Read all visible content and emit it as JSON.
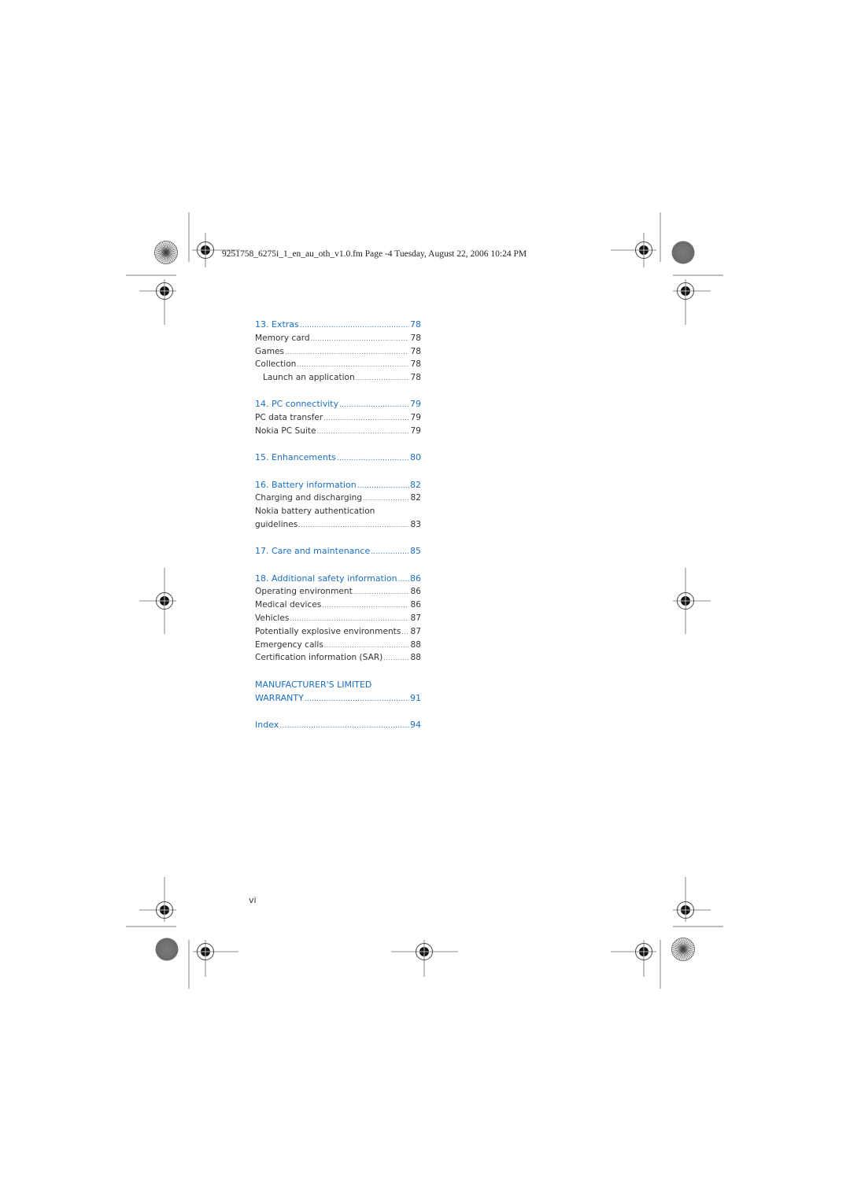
{
  "header": {
    "text": "9251758_6275i_1_en_au_oth_v1.0.fm  Page -4  Tuesday, August 22, 2006  10:24 PM"
  },
  "colors": {
    "accent": "#1a6fc0",
    "body_text": "#333333",
    "marks": "#555555"
  },
  "toc": {
    "sections": [
      {
        "chapter": {
          "label": "13. Extras",
          "page": "78"
        },
        "entries": [
          {
            "label": "Memory card",
            "page": "78",
            "indent": false
          },
          {
            "label": "Games",
            "page": "78",
            "indent": false
          },
          {
            "label": "Collection",
            "page": "78",
            "indent": false
          },
          {
            "label": "Launch an application",
            "page": "78",
            "indent": true
          }
        ]
      },
      {
        "chapter": {
          "label": "14. PC connectivity",
          "page": "79"
        },
        "entries": [
          {
            "label": "PC data transfer",
            "page": "79",
            "indent": false
          },
          {
            "label": "Nokia PC Suite",
            "page": "79",
            "indent": false
          }
        ]
      },
      {
        "chapter": {
          "label": "15. Enhancements",
          "page": "80"
        },
        "entries": []
      },
      {
        "chapter": {
          "label": "16. Battery information",
          "page": "82"
        },
        "entries": [
          {
            "label": "Charging and discharging",
            "page": "82",
            "indent": false
          },
          {
            "label": "Nokia battery authentication",
            "page": "",
            "indent": false
          },
          {
            "label": "guidelines",
            "page": "83",
            "indent": false
          }
        ]
      },
      {
        "chapter": {
          "label": "17. Care and maintenance",
          "page": "85"
        },
        "entries": []
      },
      {
        "chapter": {
          "label": "18. Additional safety information",
          "page": "86"
        },
        "entries": [
          {
            "label": "Operating environment",
            "page": "86",
            "indent": false
          },
          {
            "label": "Medical devices",
            "page": "86",
            "indent": false
          },
          {
            "label": "Vehicles",
            "page": "87",
            "indent": false
          },
          {
            "label": "Potentially explosive environments",
            "page": "87",
            "indent": false
          },
          {
            "label": "Emergency calls",
            "page": "88",
            "indent": false
          },
          {
            "label": "Certification information (SAR)",
            "page": "88",
            "indent": false
          }
        ]
      },
      {
        "chapter": {
          "label": "MANUFACTURER'S LIMITED",
          "page": ""
        },
        "chapter_cont": {
          "label": "WARRANTY",
          "page": "91"
        },
        "entries": []
      },
      {
        "chapter": {
          "label": "Index",
          "page": "94"
        },
        "entries": []
      }
    ]
  },
  "folio": "vi",
  "icons": {
    "registration_mark": "crosshair-target-icon",
    "starburst": "starburst-calibration-icon",
    "gray_disc": "gray-density-disc-icon"
  }
}
